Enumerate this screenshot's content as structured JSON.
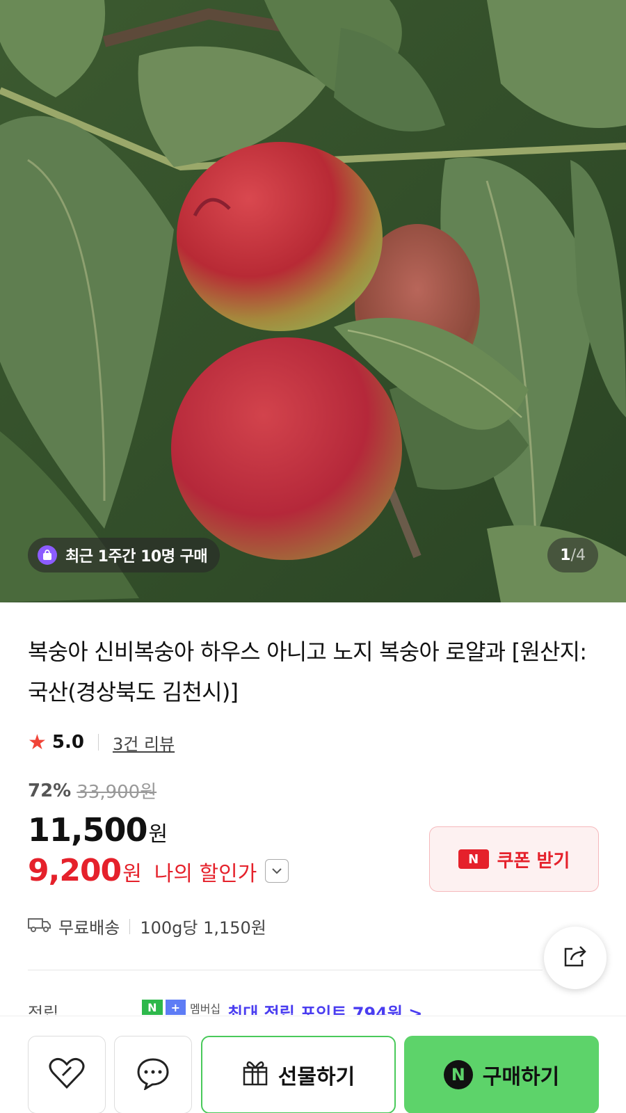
{
  "hero": {
    "recent_purchase": "최근 1주간 10명 구매",
    "counter_current": "1",
    "counter_separator": "/",
    "counter_total": "4"
  },
  "product": {
    "title": "복숭아 신비복숭아 하우스 아니고 노지 복숭아 로얄과 [원산지:국산(경상북도 김천시)]",
    "rating": "5.0",
    "review_link": "3건 리뷰",
    "discount_rate": "72%",
    "original_price": "33,900원",
    "sale_price": "11,500",
    "sale_price_unit": "원",
    "my_price": "9,200",
    "my_price_unit": "원",
    "my_price_label": "나의 할인가",
    "coupon_button": "쿠폰 받기",
    "coupon_badge": "N",
    "shipping": "무료배송",
    "unit_price": "100g당 1,150원"
  },
  "points": {
    "label": "적립",
    "badge_n": "N",
    "badge_plus": "+",
    "membership": "멤버십",
    "max_points": "최대 적립 포인트 794원 >"
  },
  "bottom_bar": {
    "gift_label": "선물하기",
    "buy_label": "구매하기",
    "buy_logo": "N"
  },
  "colors": {
    "accent_red": "#e5212b",
    "naver_green": "#5dd36a",
    "badge_purple": "#8c5cff"
  },
  "icons": [
    "bag-icon",
    "star-icon",
    "chevron-down-icon",
    "truck-icon",
    "share-icon",
    "heart-icon",
    "chat-icon",
    "gift-icon"
  ]
}
